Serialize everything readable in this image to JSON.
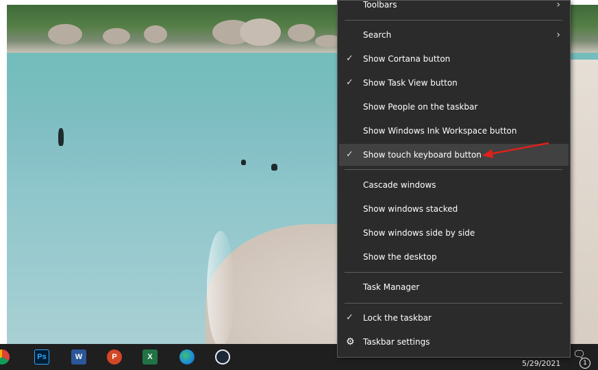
{
  "menu": {
    "toolbars_label": "Toolbars",
    "search_label": "Search",
    "show_cortana_label": "Show Cortana button",
    "show_task_view_label": "Show Task View button",
    "show_people_label": "Show People on the taskbar",
    "show_ink_label": "Show Windows Ink Workspace button",
    "show_touch_keyboard_label": "Show touch keyboard button",
    "cascade_label": "Cascade windows",
    "stacked_label": "Show windows stacked",
    "side_by_side_label": "Show windows side by side",
    "show_desktop_label": "Show the desktop",
    "task_manager_label": "Task Manager",
    "lock_taskbar_label": "Lock the taskbar",
    "taskbar_settings_label": "Taskbar settings",
    "check_glyph": "✓",
    "submenu_glyph": "›",
    "gear_glyph": "⚙"
  },
  "taskbar": {
    "ps_label": "Ps",
    "word_label": "W",
    "ppt_label": "P",
    "excel_label": "X",
    "date": "5/29/2021",
    "notification_count": "1",
    "notification_glyph": "🗨"
  },
  "colors": {
    "menu_bg": "#2b2b2b",
    "menu_highlight": "#414141",
    "taskbar_bg": "#1f1f1f",
    "annotation_arrow": "#e0201c"
  },
  "icons": [
    "chrome-icon",
    "photoshop-icon",
    "word-icon",
    "powerpoint-icon",
    "excel-icon",
    "edge-icon",
    "steam-icon",
    "gear-icon",
    "check-icon",
    "chevron-right-icon",
    "notification-icon"
  ]
}
